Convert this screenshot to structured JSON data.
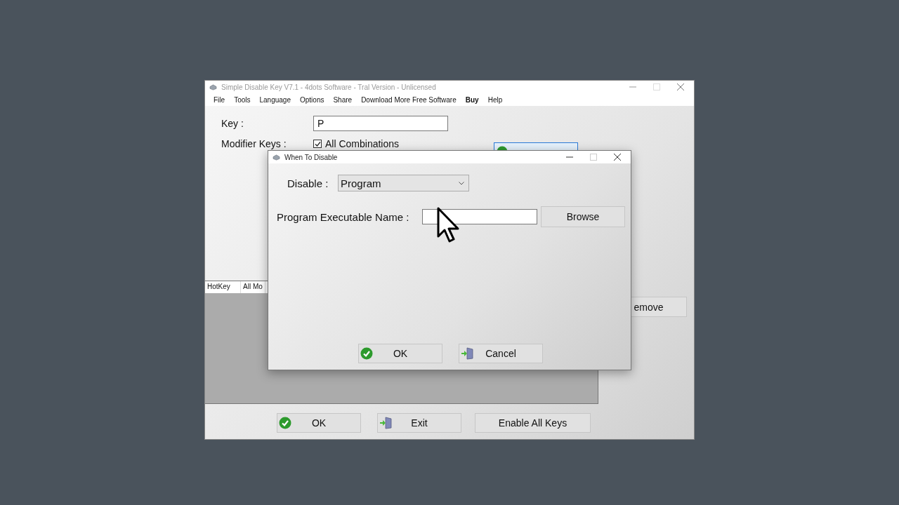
{
  "main_window": {
    "title": "Simple Disable Key V7.1 - 4dots Software - Tral Version - Unlicensed",
    "menu": [
      {
        "label": "File",
        "bold": false
      },
      {
        "label": "Tools",
        "bold": false
      },
      {
        "label": "Language",
        "bold": false
      },
      {
        "label": "Options",
        "bold": false
      },
      {
        "label": "Share",
        "bold": false
      },
      {
        "label": "Download More Free Software",
        "bold": false
      },
      {
        "label": "Buy",
        "bold": true
      },
      {
        "label": "Help",
        "bold": false
      }
    ],
    "key_label": "Key :",
    "key_value": "P",
    "modifier_label": "Modifier Keys :",
    "all_combinations": {
      "label": "All Combinations",
      "checked": true
    },
    "list_columns": [
      "HotKey",
      "All Mo"
    ],
    "remove_button": "emove",
    "buttons": [
      {
        "label": "OK",
        "kind": "check"
      },
      {
        "label": "Exit",
        "kind": "exit"
      },
      {
        "label": "Enable All Keys",
        "kind": "plain"
      }
    ]
  },
  "dialog": {
    "title": "When To Disable",
    "disable_label": "Disable :",
    "disable_value": "Program",
    "program_label": "Program Executable Name :",
    "browse": "Browse",
    "buttons": [
      {
        "label": "OK",
        "kind": "check"
      },
      {
        "label": "Cancel",
        "kind": "exit"
      }
    ]
  }
}
